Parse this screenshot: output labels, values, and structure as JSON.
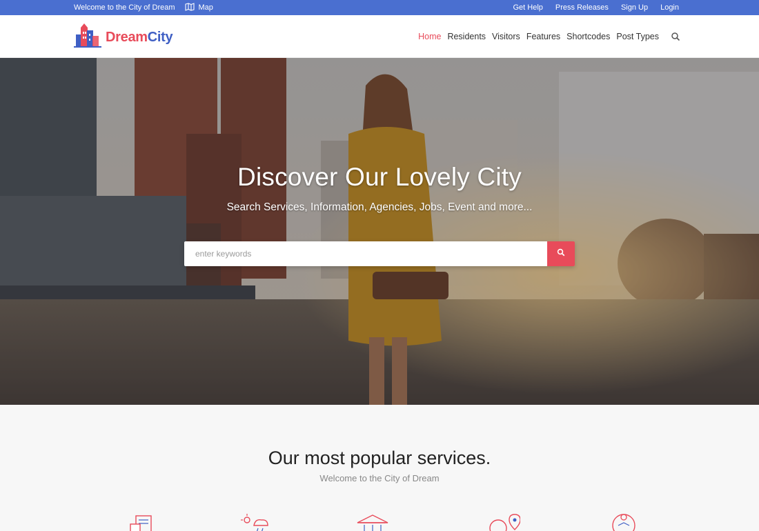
{
  "topbar": {
    "welcome": "Welcome to the City of Dream",
    "map_label": "Map",
    "links": [
      "Get Help",
      "Press Releases",
      "Sign Up",
      "Login"
    ]
  },
  "logo": {
    "part1": "Dream",
    "part2": "City"
  },
  "nav": {
    "items": [
      "Home",
      "Residents",
      "Visitors",
      "Features",
      "Shortcodes",
      "Post Types"
    ],
    "active": "Home"
  },
  "hero": {
    "title": "Discover Our Lovely City",
    "subtitle": "Search Services, Information, Agencies, Jobs, Event and more...",
    "search_placeholder": "enter keywords"
  },
  "services": {
    "title": "Our most popular services.",
    "subtitle": "Welcome to the City of Dream",
    "icons": [
      "chat-document-icon",
      "weather-icon",
      "building-icon",
      "car-location-icon",
      "person-badge-icon"
    ]
  },
  "colors": {
    "topbar": "#4a6fd0",
    "accent": "#e84b5a",
    "brand_blue": "#3f5fc4"
  }
}
